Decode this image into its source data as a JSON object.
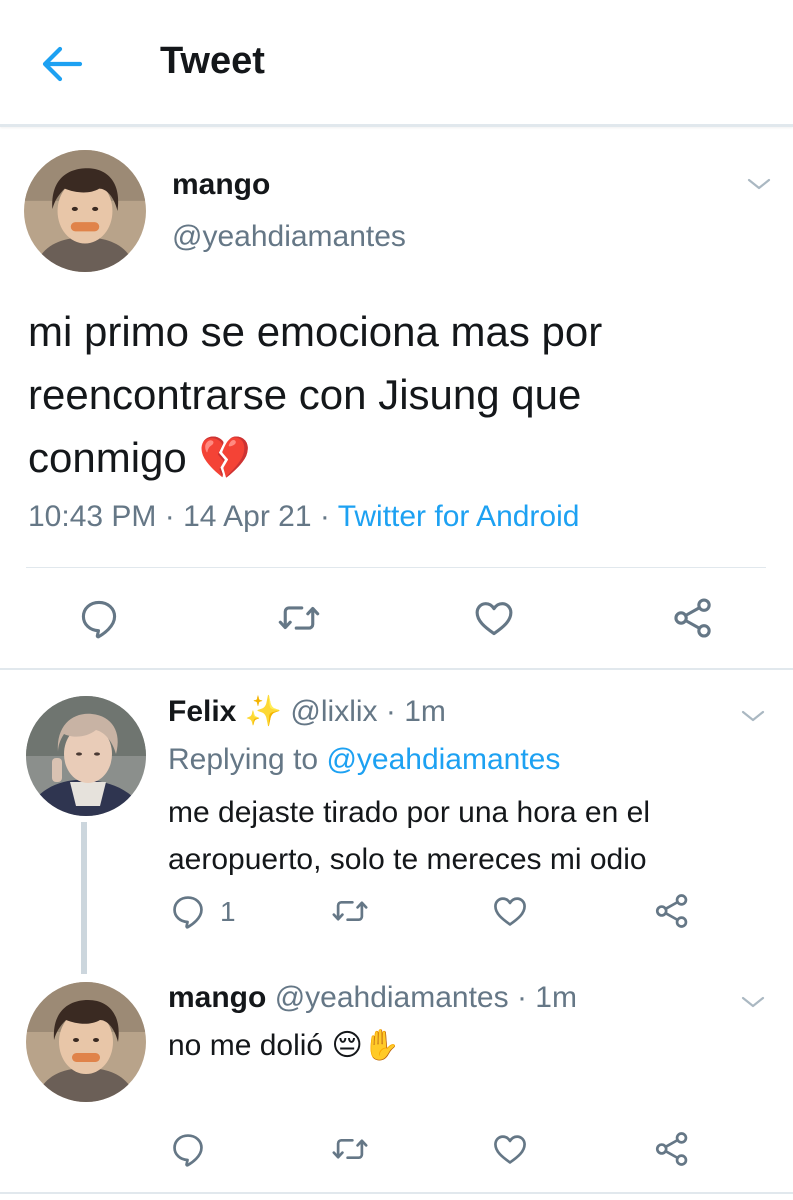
{
  "header": {
    "title": "Tweet"
  },
  "main_tweet": {
    "name": "mango",
    "handle": "@yeahdiamantes",
    "text_line1": "mi primo se emociona mas por",
    "text_line2": "reencontrarse con Jisung que",
    "text_line3": "conmigo",
    "emoji": "💔",
    "time": "10:43 PM",
    "sep1": "·",
    "date": "14 Apr 21",
    "sep2": "·",
    "source": "Twitter for Android"
  },
  "reply1": {
    "name": "Felix",
    "name_emoji": "✨",
    "handle": "@lixlix",
    "sep": "·",
    "time": "1m",
    "replying_prefix": "Replying to",
    "replying_handle": "@yeahdiamantes",
    "text_line1": "me dejaste tirado por una hora en el",
    "text_line2": "aeropuerto, solo te mereces mi odio",
    "reply_count": "1"
  },
  "reply2": {
    "name": "mango",
    "handle": "@yeahdiamantes",
    "sep": "·",
    "time": "1m",
    "text": "no me dolió",
    "emoji": "😔✋"
  },
  "icons": {
    "back": "arrow-left-icon",
    "reply": "reply-icon",
    "retweet": "retweet-icon",
    "like": "heart-icon",
    "share": "share-icon",
    "more": "chevron-down-icon"
  },
  "colors": {
    "accent": "#1da1f2",
    "muted": "#657786",
    "text": "#14171a",
    "icon": "#657786",
    "divider": "#e1e8ed"
  }
}
